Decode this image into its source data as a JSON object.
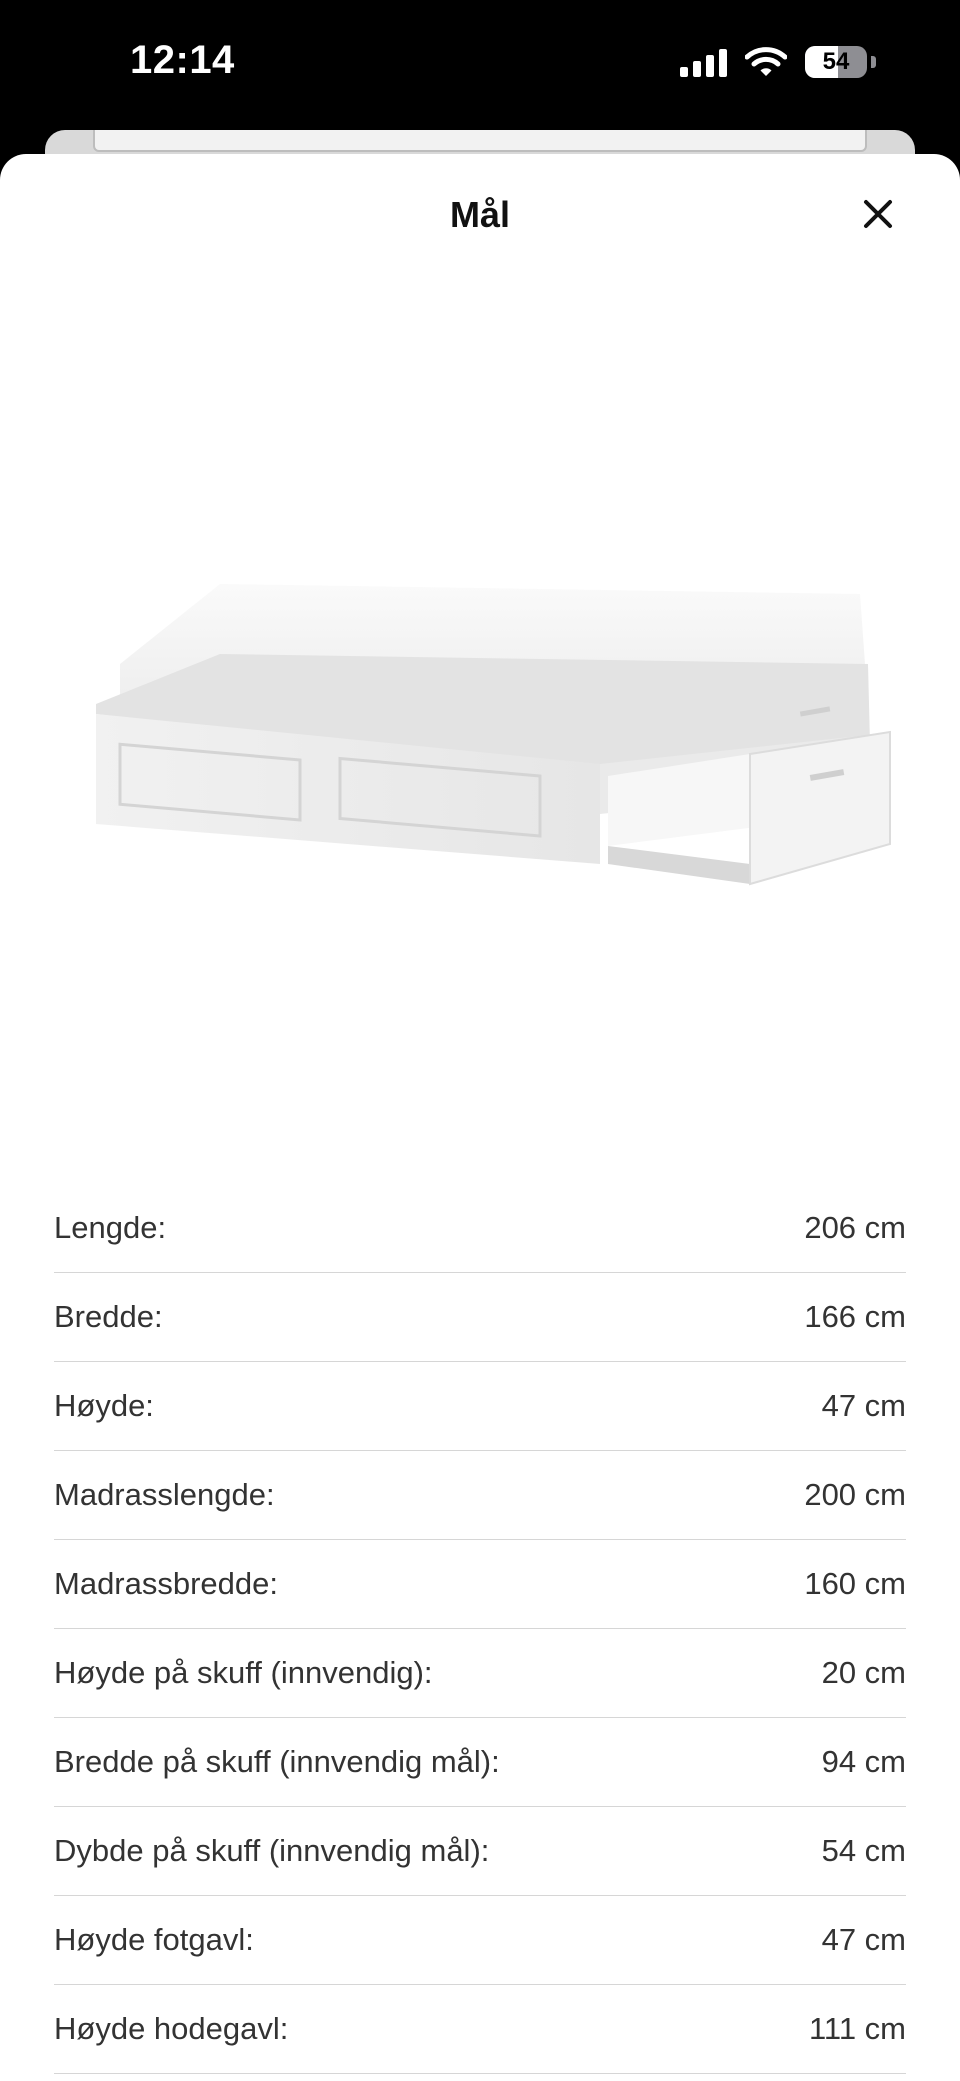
{
  "status": {
    "time": "12:14",
    "battery_level": "54"
  },
  "sheet": {
    "title": "Mål"
  },
  "dimensions": [
    {
      "label": "Lengde:",
      "value": "206 cm"
    },
    {
      "label": "Bredde:",
      "value": "166 cm"
    },
    {
      "label": "Høyde:",
      "value": "47 cm"
    },
    {
      "label": "Madrasslengde:",
      "value": "200 cm"
    },
    {
      "label": "Madrassbredde:",
      "value": "160 cm"
    },
    {
      "label": "Høyde på skuff (innvendig):",
      "value": "20 cm"
    },
    {
      "label": "Bredde på skuff (innvendig mål):",
      "value": "94 cm"
    },
    {
      "label": "Dybde på skuff (innvendig mål):",
      "value": "54 cm"
    },
    {
      "label": "Høyde fotgavl:",
      "value": "47 cm"
    },
    {
      "label": "Høyde hodegavl:",
      "value": "111 cm"
    }
  ],
  "icons": {
    "close": "close-icon",
    "signal": "cellular-signal-icon",
    "wifi": "wifi-icon",
    "battery": "battery-icon"
  }
}
